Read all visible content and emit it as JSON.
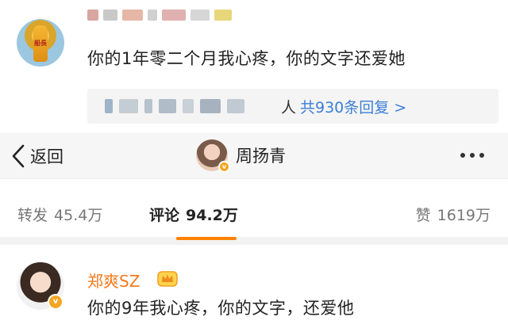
{
  "top_comment": {
    "text": "你的1年零二个月我心疼，你的文字还爱她",
    "reply_person": "人",
    "reply_link": "共930条回复 >"
  },
  "navbar": {
    "back_label": "返回",
    "user_name": "周扬青",
    "back_icon": "chevron-left-icon",
    "more_icon": "more-icon"
  },
  "tabs": {
    "repost_label": "转发",
    "repost_count": "45.4万",
    "comment_label": "评论",
    "comment_count": "94.2万",
    "like_label": "赞",
    "like_count": "1619万",
    "accent_color": "#ff8200"
  },
  "bottom_comment": {
    "user_name": "郑爽SZ",
    "text": "你的9年我心疼，你的文字，还爱他",
    "name_color": "#f57a1d"
  },
  "bottle_label": "船長"
}
